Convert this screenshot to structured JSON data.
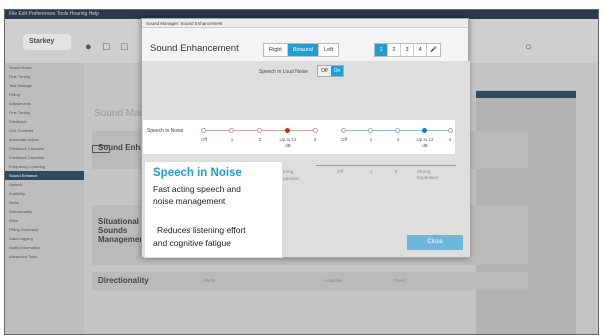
{
  "background_app": {
    "menubar_text": "File Edit Preferences Tools Hearing Help",
    "logo": "Starkey",
    "sidebar_items": [
      "Sound Noise",
      "Fine Tuning",
      "Test Manage",
      "Fitting",
      "Adjustments",
      "Fine Tuning",
      "Feedback",
      "Live Contexts",
      "Automatic Adjust",
      "Feedback Canceller",
      "Feedback Canceller",
      "Frequency Lowering",
      "Sound Enhance",
      "Speech",
      "Audibility",
      "Noise",
      "Directionality",
      "Wind",
      "Fitting Summary",
      "Data Logging",
      "Notify Information",
      "Advanced Tools"
    ],
    "sidebar_selected_index": 12,
    "main_title": "Sound Mana",
    "rows": [
      "Sound Enhance",
      "Situational Sounds Management",
      "Directionality"
    ],
    "dir_cells": [
      "Mode",
      "Adaptive",
      "Fixed"
    ]
  },
  "dialog": {
    "title": "Sound Manager: Sound Enhancement",
    "heading": "Sound Enhancement",
    "sides": [
      {
        "label": "Right",
        "active": false
      },
      {
        "label": "Binaural",
        "active": true
      },
      {
        "label": "Left",
        "active": false
      }
    ],
    "programs": [
      "1",
      "2",
      "3",
      "4"
    ],
    "selected_program": "1",
    "program_icon": "microphone-icon",
    "loud_label": "Speech in Loud Noise",
    "toggle": {
      "off": "Off",
      "on": "On",
      "selected": "On"
    },
    "close_label": "Close"
  },
  "speech_in_noise": {
    "label": "Speech in Noise",
    "left_ticks": [
      "Off",
      "1",
      "2",
      "Up to 12 dB"
    ],
    "left_selected_index": 3,
    "right_ticks": [
      "Off",
      "1",
      "2",
      "Up to 12 dB"
    ],
    "right_selected_index": 3,
    "left_color": "#c62828",
    "right_color": "#1a7cc0"
  },
  "faded_row": {
    "left_labels": [
      "Strong",
      "Expansion"
    ],
    "right_ticks": [
      "Off",
      "1",
      "2",
      "Strong Expansion"
    ]
  },
  "callout": {
    "title": "Speech in Noise",
    "line1": "Fast acting speech and",
    "line2": "noise management",
    "line3": "Reduces listening effort",
    "line4": "and cognitive fatigue"
  }
}
